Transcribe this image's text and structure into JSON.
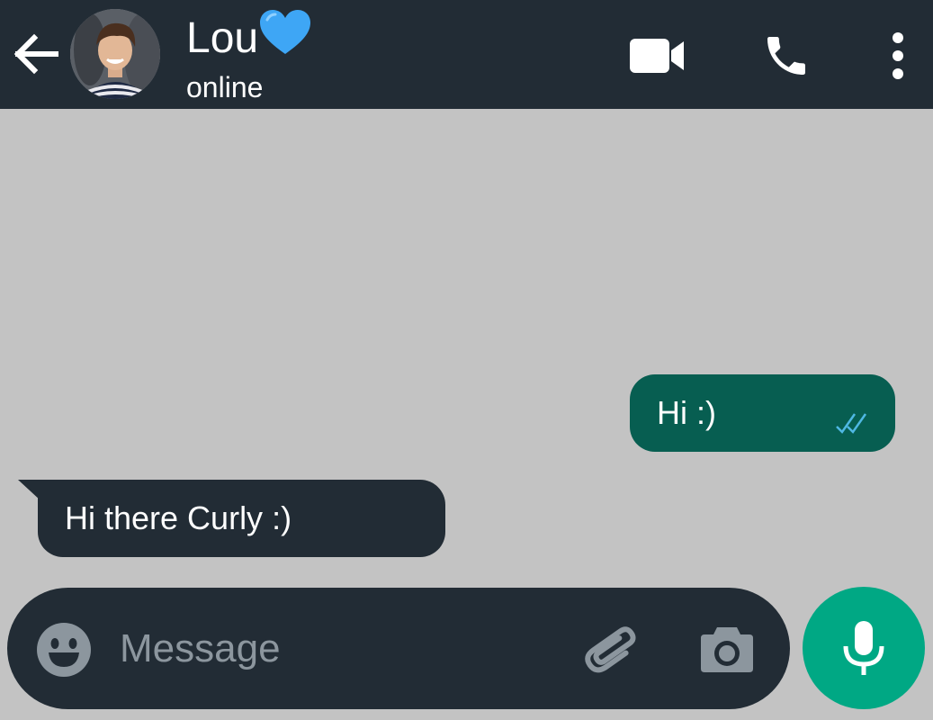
{
  "header": {
    "contact_name": "Lou",
    "contact_status": "online",
    "icons": [
      "back-arrow-icon",
      "video-call-icon",
      "phone-icon",
      "more-options-icon"
    ],
    "background": "#222c35"
  },
  "messages": [
    {
      "direction": "outgoing",
      "text": "Hi :)",
      "status": "read",
      "bubble_color": "#075e51"
    },
    {
      "direction": "incoming",
      "text": "Hi there Curly :)",
      "bubble_color": "#222c35"
    }
  ],
  "composer": {
    "placeholder": "Message",
    "value": "",
    "icons": [
      "emoji-icon",
      "attach-icon",
      "camera-icon",
      "microphone-icon"
    ]
  },
  "colors": {
    "chat_background": "#c3c3c3",
    "accent": "#00a884",
    "read_tick": "#4fb8e3",
    "heart": "#3ea6f5"
  }
}
